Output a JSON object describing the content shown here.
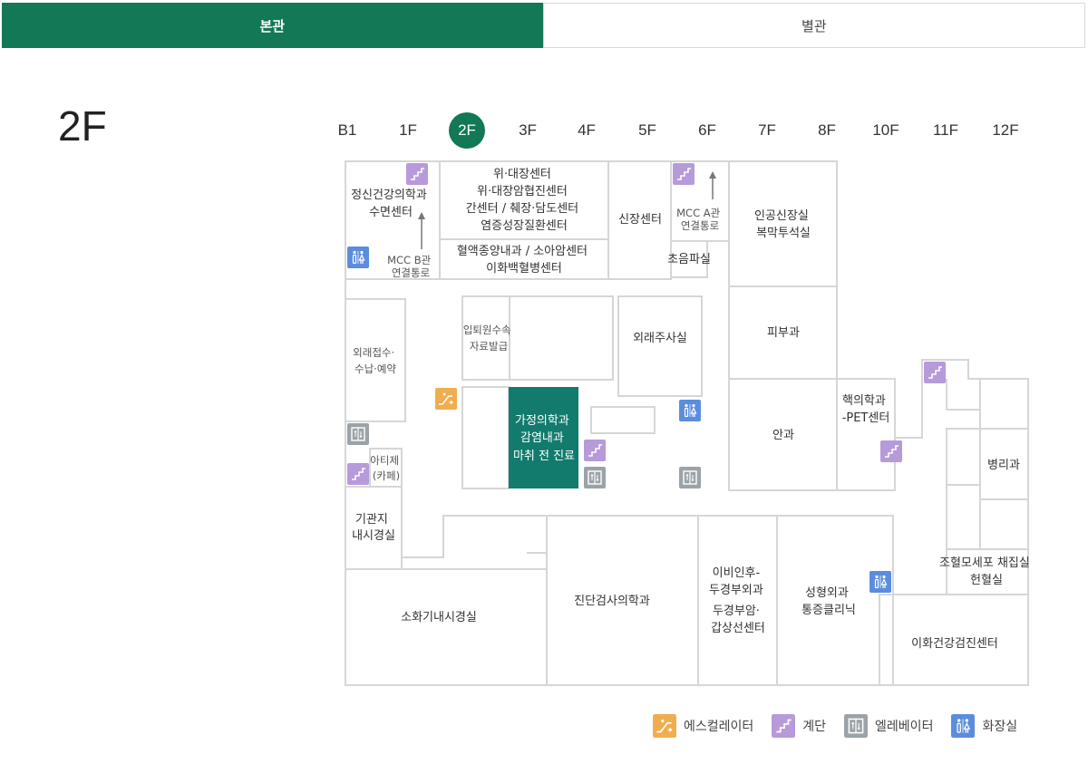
{
  "tabs": [
    {
      "label": "본관",
      "active": true
    },
    {
      "label": "별관",
      "active": false
    }
  ],
  "floor_title": "2F",
  "floors": [
    "B1",
    "1F",
    "2F",
    "3F",
    "4F",
    "5F",
    "6F",
    "7F",
    "8F",
    "10F",
    "11F",
    "12F"
  ],
  "selected_floor": "2F",
  "colors": {
    "brand": "#127856",
    "highlight_room": "#127b6d",
    "escalator": "#f0ad4e",
    "stairs": "#b79ad9",
    "elevator": "#9aa3a8",
    "restroom": "#5b8dde",
    "wall": "#d6d6d6"
  },
  "rooms": {
    "psychiatry": [
      "정신건강의학과",
      "수면센터"
    ],
    "mcc_b": [
      "MCC B관",
      "연결통로"
    ],
    "gi_center": [
      "위·대장센터",
      "위·대장암협진센터",
      "간센터 / 췌장·담도센터",
      "염증성장질환센터"
    ],
    "hemato": [
      "혈액종양내과 / 소아암센터",
      "이화백혈병센터"
    ],
    "kidney": [
      "신장센터"
    ],
    "mcc_a": [
      "MCC A관",
      "연결통로"
    ],
    "ultrasound": [
      "초음파실"
    ],
    "dialysis": [
      "인공신장실",
      "복막투석실"
    ],
    "reception": [
      "외래접수·",
      "수납·예약"
    ],
    "records": [
      "입퇴원수속",
      "자료발급"
    ],
    "injection": [
      "외래주사실"
    ],
    "dermatology": [
      "피부과"
    ],
    "family_med": [
      "가정의학과",
      "감염내과",
      "마취 전 진료"
    ],
    "ophthalmology": [
      "안과"
    ],
    "nuclear": [
      "핵의학과",
      "-PET센터"
    ],
    "cafe": [
      "아티제",
      "(카페)"
    ],
    "pathology": [
      "병리과"
    ],
    "bronchoscopy": [
      "기관지",
      "내시경실"
    ],
    "stem_cell": [
      "조혈모세포 채집실",
      "헌혈실"
    ],
    "gi_endoscopy": [
      "소화기내시경실"
    ],
    "lab_medicine": [
      "진단검사의학과"
    ],
    "ent": [
      "이비인후-",
      "두경부외과",
      "두경부암·",
      "갑상선센터"
    ],
    "plastic": [
      "성형외과",
      "통증클리닉"
    ],
    "checkup": [
      "이화건강검진센터"
    ]
  },
  "legend": [
    {
      "icon": "escalator-icon",
      "label": "에스컬레이터"
    },
    {
      "icon": "stairs-icon",
      "label": "계단"
    },
    {
      "icon": "elevator-icon",
      "label": "엘레베이터"
    },
    {
      "icon": "restroom-icon",
      "label": "화장실"
    }
  ]
}
